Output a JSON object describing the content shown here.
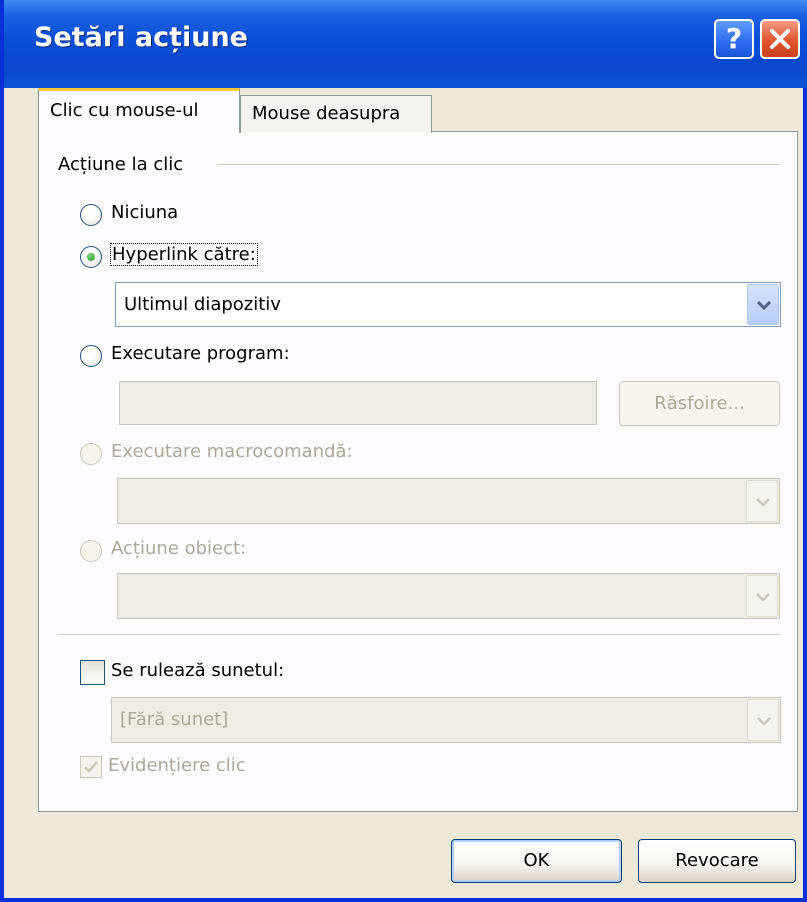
{
  "window": {
    "title": "Setări acțiune",
    "help_label": "?"
  },
  "tabs": [
    {
      "label": "Clic cu mouse-ul",
      "selected": true
    },
    {
      "label": "Mouse deasupra",
      "selected": false
    }
  ],
  "group": {
    "title": "Acțiune la clic"
  },
  "options": {
    "none": {
      "label": "Niciuna",
      "selected": false
    },
    "hyperlink": {
      "label": "Hyperlink către:",
      "selected": true,
      "value": "Ultimul diapozitiv"
    },
    "run_program": {
      "label": "Executare program:",
      "selected": false,
      "value": "",
      "browse_label": "Răsfoire..."
    },
    "run_macro": {
      "label": "Executare macrocomandă:",
      "enabled": false,
      "value": ""
    },
    "object_action": {
      "label": "Acțiune obiect:",
      "enabled": false,
      "value": ""
    }
  },
  "sound": {
    "label": "Se rulează sunetul:",
    "checked": false,
    "value": "[Fără sunet]"
  },
  "highlight": {
    "label": "Evidențiere clic",
    "checked": true,
    "enabled": false
  },
  "buttons": {
    "ok": "OK",
    "cancel": "Revocare"
  },
  "colors": {
    "titlebar": "#0b4fd8",
    "dialog_bg": "#ece9d8",
    "radio_dot": "#21a121",
    "disabled_text": "#aca899",
    "tab_highlight": "#ffc73c"
  }
}
